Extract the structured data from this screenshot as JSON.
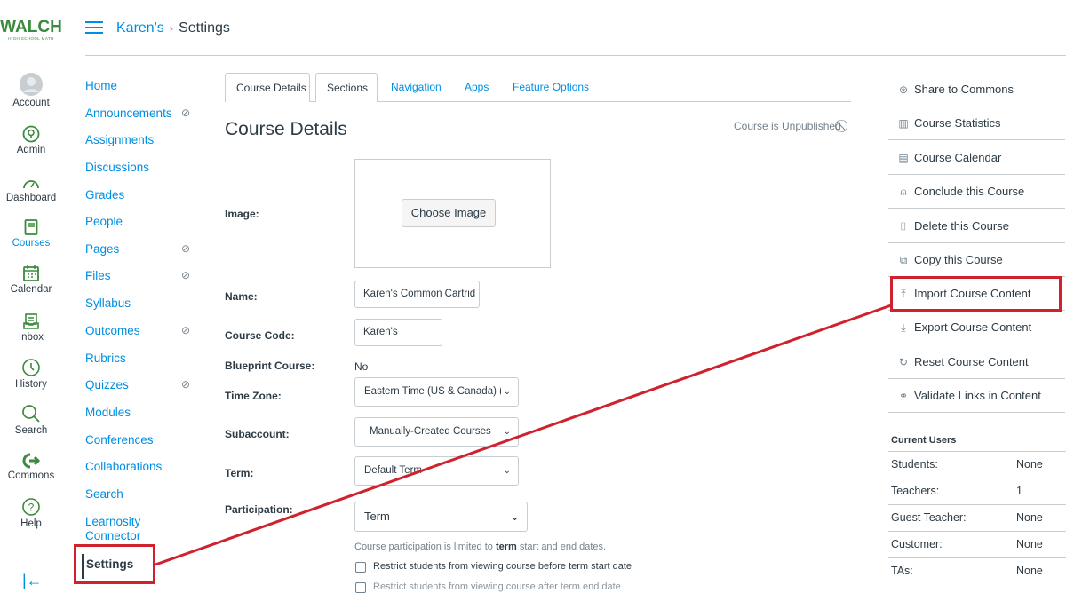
{
  "logo": {
    "text": "WALCH",
    "subtext": "HIGH SCHOOL MATH"
  },
  "global_nav": [
    {
      "label": "Account",
      "icon": "avatar-icon"
    },
    {
      "label": "Admin",
      "icon": "shield-icon"
    },
    {
      "label": "Dashboard",
      "icon": "dashboard-icon"
    },
    {
      "label": "Courses",
      "icon": "book-icon"
    },
    {
      "label": "Calendar",
      "icon": "calendar-icon"
    },
    {
      "label": "Inbox",
      "icon": "inbox-icon"
    },
    {
      "label": "History",
      "icon": "clock-icon"
    },
    {
      "label": "Search",
      "icon": "search-icon"
    },
    {
      "label": "Commons",
      "icon": "commons-icon"
    },
    {
      "label": "Help",
      "icon": "help-icon"
    }
  ],
  "breadcrumb": {
    "course": "Karen's",
    "separator": "›",
    "page": "Settings"
  },
  "course_nav": [
    {
      "label": "Home",
      "hidden": false
    },
    {
      "label": "Announcements",
      "hidden": true
    },
    {
      "label": "Assignments",
      "hidden": false
    },
    {
      "label": "Discussions",
      "hidden": false
    },
    {
      "label": "Grades",
      "hidden": false
    },
    {
      "label": "People",
      "hidden": false
    },
    {
      "label": "Pages",
      "hidden": true
    },
    {
      "label": "Files",
      "hidden": true
    },
    {
      "label": "Syllabus",
      "hidden": false
    },
    {
      "label": "Outcomes",
      "hidden": true
    },
    {
      "label": "Rubrics",
      "hidden": false
    },
    {
      "label": "Quizzes",
      "hidden": true
    },
    {
      "label": "Modules",
      "hidden": false
    },
    {
      "label": "Conferences",
      "hidden": false
    },
    {
      "label": "Collaborations",
      "hidden": false
    },
    {
      "label": "Search",
      "hidden": false
    },
    {
      "label": "Learnosity Connector",
      "hidden": false
    },
    {
      "label": "Settings",
      "hidden": false,
      "active": true
    }
  ],
  "tabs": [
    "Course Details",
    "Sections",
    "Navigation",
    "Apps",
    "Feature Options"
  ],
  "main": {
    "title": "Course Details",
    "publish_status": "Course is Unpublished",
    "image_label": "Image:",
    "choose_image": "Choose Image",
    "name_label": "Name:",
    "name_value": "Karen's Common Cartrid",
    "code_label": "Course Code:",
    "code_value": "Karen's",
    "blueprint_label": "Blueprint Course:",
    "blueprint_value": "No",
    "timezone_label": "Time Zone:",
    "timezone_value": "Eastern Time (US & Canada) (",
    "subaccount_label": "Subaccount:",
    "subaccount_value": "Manually-Created Courses",
    "term_label": "Term:",
    "term_value": "Default Term",
    "participation_label": "Participation:",
    "participation_value": "Term",
    "participation_hint_pre": "Course participation is limited to ",
    "participation_hint_bold": "term",
    "participation_hint_post": " start and end dates.",
    "restrict_before": "Restrict students from viewing course before term start date",
    "restrict_after": "Restrict students from viewing course after term end date"
  },
  "right_actions": [
    {
      "label": "Share to Commons",
      "icon": "share-icon"
    },
    {
      "label": "Course Statistics",
      "icon": "stats-icon"
    },
    {
      "label": "Course Calendar",
      "icon": "calendar-icon"
    },
    {
      "label": "Conclude this Course",
      "icon": "lock-icon"
    },
    {
      "label": "Delete this Course",
      "icon": "trash-icon"
    },
    {
      "label": "Copy this Course",
      "icon": "copy-icon"
    },
    {
      "label": "Import Course Content",
      "icon": "upload-icon"
    },
    {
      "label": "Export Course Content",
      "icon": "download-icon"
    },
    {
      "label": "Reset Course Content",
      "icon": "reset-icon"
    },
    {
      "label": "Validate Links in Content",
      "icon": "link-icon"
    }
  ],
  "current_users": {
    "title": "Current Users",
    "rows": [
      {
        "k": "Students:",
        "v": "None"
      },
      {
        "k": "Teachers:",
        "v": "1"
      },
      {
        "k": "Guest Teacher:",
        "v": "None"
      },
      {
        "k": "Customer:",
        "v": "None"
      },
      {
        "k": "TAs:",
        "v": "None"
      }
    ]
  },
  "colors": {
    "accent": "#008ee2",
    "annotation": "#d0222e",
    "brand": "#3b8a3e"
  }
}
